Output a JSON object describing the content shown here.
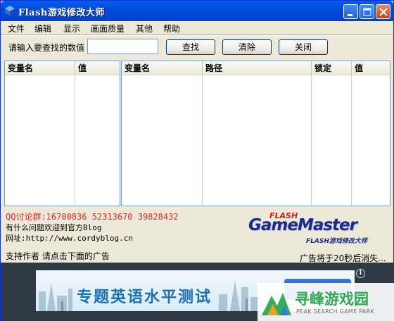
{
  "window": {
    "title": "Flash游戏修改大师"
  },
  "menu": [
    "文件",
    "编辑",
    "显示",
    "画面质量",
    "其他",
    "帮助"
  ],
  "search": {
    "label": "请输入要查找的数值",
    "value": "",
    "find_label": "查找",
    "clear_label": "清除",
    "close_label": "关闭"
  },
  "left_table": {
    "columns": [
      "变量名",
      "值"
    ]
  },
  "right_table": {
    "columns": [
      "变量名",
      "路径",
      "锁定",
      "值"
    ]
  },
  "info": {
    "qq": "QQ讨论群:16700836 52313670 39828432",
    "question": "有什么问题欢迎到官方Blog",
    "url": "网址:http://www.cordyblog.cn",
    "support": "支持作者 请点击下面的广告",
    "countdown": "广告将于20秒后消失..."
  },
  "logo": {
    "flash": "FLASH",
    "main": "GameMaster",
    "sub": "FLASH游戏修改大师"
  },
  "ad": {
    "text": "专题英语水平测试"
  },
  "watermark": {
    "text": "寻峰游戏园",
    "sub": "PEAK SEARCH GAME PARK"
  },
  "colors": {
    "titlebar": "#0149d8",
    "qq_text": "#e62828",
    "logo": "#1d2a8a",
    "watermark": "#32a852"
  },
  "icons": [
    "app-icon",
    "minimize-icon",
    "maximize-icon",
    "close-icon",
    "info-icon"
  ]
}
